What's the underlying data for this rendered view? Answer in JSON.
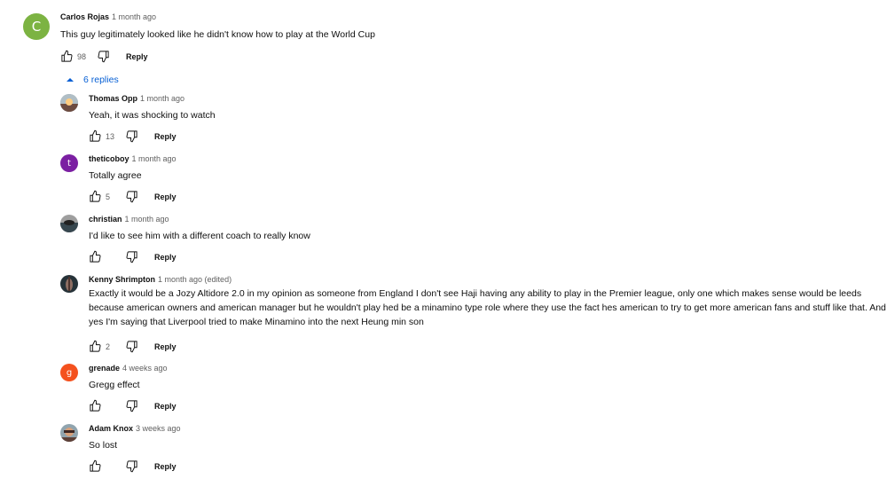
{
  "top": {
    "author": "Carlos Rojas",
    "time": "1 month ago",
    "text": "This guy legitimately looked like he didn't know how to play at the World Cup",
    "likes": "98",
    "reply": "Reply",
    "initial": "C",
    "color": "#7cb342"
  },
  "replies_toggle": "6 replies",
  "replies": [
    {
      "author": "Thomas Opp",
      "time": "1 month ago",
      "text": "Yeah, it was shocking to watch",
      "likes": "13",
      "reply": "Reply"
    },
    {
      "author": "theticoboy",
      "time": "1 month ago",
      "text": "Totally agree",
      "likes": "5",
      "reply": "Reply",
      "initial": "t",
      "color": "#7b1fa2"
    },
    {
      "author": "christian",
      "time": "1 month ago",
      "text": "I'd like to see him with a different coach to really know",
      "likes": "",
      "reply": "Reply"
    },
    {
      "author": "Kenny Shrimpton",
      "time": "1 month ago (edited)",
      "text": "Exactly it would be a Jozy Altidore 2.0 in my opinion as someone from England I don't see Haji having any ability to play in the Premier league, only one which makes sense would be leeds because american owners and american manager but he wouldn't play hed be a minamino type role where they use the fact hes american to try to get more american fans and stuff like that. And yes I'm saying that Liverpool tried to make Minamino into the next Heung min son",
      "likes": "2",
      "reply": "Reply"
    },
    {
      "author": "grenade",
      "time": "4 weeks ago",
      "text": "Gregg effect",
      "likes": "",
      "reply": "Reply",
      "initial": "g",
      "color": "#f4511e"
    },
    {
      "author": "Adam Knox",
      "time": "3 weeks ago",
      "text": "So lost",
      "likes": "",
      "reply": "Reply"
    }
  ]
}
